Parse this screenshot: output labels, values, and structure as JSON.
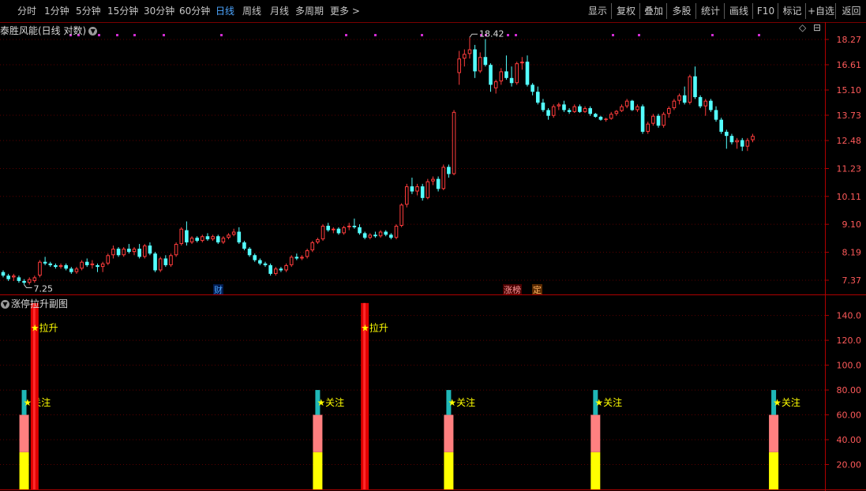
{
  "toolbar": {
    "periods": [
      "分时",
      "1分钟",
      "5分钟",
      "15分钟",
      "30分钟",
      "60分钟",
      "日线",
      "周线",
      "月线",
      "多周期",
      "更多"
    ],
    "active_period": "日线",
    "more_arrow": ">",
    "right_buttons": [
      "显示",
      "复权",
      "叠加",
      "多股",
      "统计",
      "画线",
      "F10",
      "标记",
      "+自选",
      "返回"
    ]
  },
  "main_chart": {
    "title": "泰胜风能(日线 对数)",
    "diamond_icon": "◇",
    "settings_icon": "⊟",
    "high_label": "18.42",
    "low_label": "7.25",
    "y_ticks": [
      "18.27",
      "16.61",
      "15.10",
      "13.73",
      "12.48",
      "11.23",
      "10.11",
      "9.10",
      "8.19",
      "7.37"
    ],
    "markers": {
      "cai": "财",
      "zhangbang": "涨榜",
      "ding": "定"
    }
  },
  "sub_chart": {
    "title": "涨停拉升副图",
    "y_ticks": [
      "140.0",
      "120.0",
      "100.0",
      "80.00",
      "60.00",
      "40.00",
      "20.00"
    ],
    "label_lasheng": "拉升",
    "label_guanzhu": "关注",
    "star": "★"
  },
  "chart_data": [
    {
      "type": "candlestick",
      "title": "泰胜风能(日线 对数)",
      "y_scale": "log",
      "ylim": [
        7.0,
        19.0
      ],
      "y_ticks": [
        18.27,
        16.61,
        15.1,
        13.73,
        12.48,
        11.23,
        10.11,
        9.1,
        8.19,
        7.37
      ],
      "annotations": {
        "high": 18.42,
        "low": 7.25
      },
      "colors": {
        "up": "#ff3c3c",
        "down": "#54ffff"
      },
      "candles": [
        [
          7.6,
          7.65,
          7.45,
          7.5
        ],
        [
          7.5,
          7.55,
          7.35,
          7.4
        ],
        [
          7.45,
          7.55,
          7.35,
          7.5
        ],
        [
          7.45,
          7.5,
          7.3,
          7.35
        ],
        [
          7.35,
          7.4,
          7.25,
          7.3
        ],
        [
          7.3,
          7.45,
          7.25,
          7.4
        ],
        [
          7.35,
          7.5,
          7.3,
          7.45
        ],
        [
          7.5,
          7.95,
          7.45,
          7.9
        ],
        [
          7.9,
          8.05,
          7.8,
          7.85
        ],
        [
          7.85,
          7.9,
          7.75,
          7.8
        ],
        [
          7.8,
          7.85,
          7.7,
          7.75
        ],
        [
          7.75,
          7.85,
          7.7,
          7.8
        ],
        [
          7.8,
          7.85,
          7.65,
          7.7
        ],
        [
          7.7,
          7.75,
          7.55,
          7.6
        ],
        [
          7.6,
          7.75,
          7.55,
          7.7
        ],
        [
          7.7,
          7.95,
          7.65,
          7.9
        ],
        [
          7.9,
          8.0,
          7.75,
          7.8
        ],
        [
          7.8,
          7.95,
          7.7,
          7.85
        ],
        [
          7.8,
          7.85,
          7.6,
          7.75
        ],
        [
          7.75,
          7.9,
          7.6,
          7.85
        ],
        [
          7.85,
          8.15,
          7.8,
          8.1
        ],
        [
          8.1,
          8.4,
          8.0,
          8.3
        ],
        [
          8.3,
          8.35,
          8.05,
          8.1
        ],
        [
          8.1,
          8.35,
          8.05,
          8.3
        ],
        [
          8.3,
          8.45,
          8.15,
          8.2
        ],
        [
          8.2,
          8.35,
          8.1,
          8.3
        ],
        [
          8.3,
          8.45,
          8.0,
          8.05
        ],
        [
          8.05,
          8.45,
          8.0,
          8.4
        ],
        [
          8.4,
          8.5,
          8.1,
          8.15
        ],
        [
          8.15,
          8.2,
          7.6,
          7.65
        ],
        [
          7.65,
          8.05,
          7.6,
          8.0
        ],
        [
          8.0,
          8.1,
          7.75,
          7.8
        ],
        [
          7.8,
          8.15,
          7.75,
          8.1
        ],
        [
          8.1,
          8.5,
          8.05,
          8.45
        ],
        [
          8.45,
          9.0,
          8.4,
          8.95
        ],
        [
          8.9,
          9.2,
          8.4,
          8.5
        ],
        [
          8.5,
          8.7,
          8.45,
          8.65
        ],
        [
          8.65,
          8.7,
          8.5,
          8.55
        ],
        [
          8.55,
          8.75,
          8.5,
          8.7
        ],
        [
          8.7,
          8.8,
          8.55,
          8.6
        ],
        [
          8.6,
          8.75,
          8.55,
          8.7
        ],
        [
          8.7,
          8.75,
          8.45,
          8.5
        ],
        [
          8.5,
          8.7,
          8.45,
          8.65
        ],
        [
          8.65,
          8.8,
          8.6,
          8.75
        ],
        [
          8.75,
          8.95,
          8.7,
          8.85
        ],
        [
          8.85,
          9.0,
          8.45,
          8.5
        ],
        [
          8.5,
          8.55,
          8.25,
          8.3
        ],
        [
          8.3,
          8.35,
          8.05,
          8.1
        ],
        [
          8.1,
          8.15,
          7.9,
          7.95
        ],
        [
          7.95,
          8.0,
          7.8,
          7.85
        ],
        [
          7.85,
          7.9,
          7.75,
          7.8
        ],
        [
          7.8,
          7.85,
          7.5,
          7.55
        ],
        [
          7.55,
          7.75,
          7.5,
          7.7
        ],
        [
          7.7,
          7.75,
          7.6,
          7.65
        ],
        [
          7.65,
          7.85,
          7.6,
          7.8
        ],
        [
          7.8,
          8.1,
          7.75,
          8.05
        ],
        [
          8.05,
          8.15,
          7.95,
          8.0
        ],
        [
          8.0,
          8.1,
          7.95,
          8.05
        ],
        [
          8.05,
          8.3,
          8.0,
          8.25
        ],
        [
          8.25,
          8.55,
          8.2,
          8.5
        ],
        [
          8.5,
          8.65,
          8.45,
          8.6
        ],
        [
          8.6,
          9.1,
          8.55,
          9.05
        ],
        [
          9.05,
          9.15,
          8.85,
          8.9
        ],
        [
          8.9,
          9.0,
          8.8,
          8.95
        ],
        [
          8.95,
          9.0,
          8.75,
          8.8
        ],
        [
          8.8,
          9.05,
          8.75,
          9.0
        ],
        [
          9.0,
          9.15,
          8.9,
          9.05
        ],
        [
          9.05,
          9.3,
          8.95,
          9.0
        ],
        [
          9.0,
          9.1,
          8.75,
          8.8
        ],
        [
          8.8,
          8.85,
          8.6,
          8.65
        ],
        [
          8.65,
          8.8,
          8.6,
          8.75
        ],
        [
          8.75,
          8.85,
          8.65,
          8.7
        ],
        [
          8.7,
          8.9,
          8.65,
          8.85
        ],
        [
          8.85,
          8.9,
          8.7,
          8.75
        ],
        [
          8.75,
          8.8,
          8.6,
          8.65
        ],
        [
          8.65,
          9.1,
          8.6,
          9.05
        ],
        [
          9.05,
          9.85,
          9.0,
          9.8
        ],
        [
          9.8,
          10.6,
          9.7,
          10.5
        ],
        [
          10.5,
          10.85,
          10.2,
          10.3
        ],
        [
          10.3,
          10.6,
          10.15,
          10.5
        ],
        [
          10.5,
          10.6,
          9.95,
          10.05
        ],
        [
          10.05,
          10.8,
          10.0,
          10.7
        ],
        [
          10.7,
          10.9,
          10.55,
          10.8
        ],
        [
          10.8,
          10.9,
          10.3,
          10.4
        ],
        [
          10.4,
          11.4,
          10.35,
          11.3
        ],
        [
          11.3,
          11.4,
          10.85,
          11.0
        ],
        [
          11.0,
          14.0,
          10.95,
          13.9
        ],
        [
          16.1,
          17.5,
          15.4,
          17.0
        ],
        [
          17.0,
          17.6,
          16.5,
          17.3
        ],
        [
          17.3,
          18.42,
          17.0,
          17.6
        ],
        [
          17.6,
          17.9,
          15.8,
          16.2
        ],
        [
          16.2,
          17.4,
          16.1,
          17.1
        ],
        [
          17.1,
          18.3,
          16.5,
          16.6
        ],
        [
          16.6,
          16.7,
          15.0,
          15.4
        ],
        [
          15.2,
          15.7,
          14.9,
          15.6
        ],
        [
          15.6,
          16.4,
          15.4,
          16.2
        ],
        [
          16.2,
          17.2,
          15.7,
          15.8
        ],
        [
          15.8,
          16.5,
          15.3,
          15.5
        ],
        [
          15.5,
          16.8,
          15.4,
          16.7
        ],
        [
          16.7,
          17.1,
          16.3,
          16.8
        ],
        [
          16.8,
          17.2,
          15.3,
          15.4
        ],
        [
          15.4,
          15.5,
          14.8,
          15.0
        ],
        [
          15.0,
          15.3,
          14.3,
          14.4
        ],
        [
          14.4,
          14.6,
          13.9,
          14.0
        ],
        [
          14.0,
          14.1,
          13.5,
          13.7
        ],
        [
          13.7,
          14.3,
          13.6,
          14.2
        ],
        [
          14.2,
          14.4,
          14.0,
          14.3
        ],
        [
          14.3,
          14.5,
          13.9,
          14.0
        ],
        [
          14.0,
          14.1,
          13.8,
          13.9
        ],
        [
          13.9,
          14.3,
          13.85,
          14.2
        ],
        [
          14.2,
          14.3,
          13.85,
          13.9
        ],
        [
          13.9,
          14.2,
          13.85,
          14.1
        ],
        [
          14.1,
          14.2,
          13.7,
          13.8
        ],
        [
          13.8,
          13.85,
          13.6,
          13.65
        ],
        [
          13.65,
          13.7,
          13.45,
          13.5
        ],
        [
          13.5,
          13.6,
          13.4,
          13.55
        ],
        [
          13.55,
          13.9,
          13.5,
          13.8
        ],
        [
          13.8,
          14.0,
          13.7,
          13.95
        ],
        [
          13.95,
          14.3,
          13.9,
          14.2
        ],
        [
          14.2,
          14.6,
          14.1,
          14.5
        ],
        [
          14.5,
          14.55,
          13.95,
          14.0
        ],
        [
          14.0,
          14.3,
          13.9,
          14.2
        ],
        [
          14.2,
          14.3,
          12.8,
          12.9
        ],
        [
          12.9,
          13.4,
          12.8,
          13.3
        ],
        [
          13.3,
          13.8,
          13.2,
          13.7
        ],
        [
          13.7,
          13.8,
          13.1,
          13.2
        ],
        [
          13.2,
          13.9,
          13.1,
          13.8
        ],
        [
          13.8,
          14.2,
          13.6,
          14.1
        ],
        [
          14.1,
          14.6,
          14.0,
          14.5
        ],
        [
          14.5,
          14.9,
          14.3,
          14.8
        ],
        [
          14.8,
          15.3,
          14.3,
          14.4
        ],
        [
          14.4,
          16.0,
          14.3,
          15.9
        ],
        [
          15.9,
          16.5,
          14.6,
          14.7
        ],
        [
          14.7,
          14.8,
          14.1,
          14.2
        ],
        [
          14.2,
          14.6,
          13.7,
          14.5
        ],
        [
          14.5,
          14.6,
          13.9,
          14.0
        ],
        [
          14.0,
          14.2,
          13.4,
          13.5
        ],
        [
          13.5,
          13.6,
          12.8,
          12.9
        ],
        [
          12.9,
          13.0,
          12.1,
          12.7
        ],
        [
          12.7,
          12.8,
          12.3,
          12.4
        ],
        [
          12.4,
          12.6,
          12.1,
          12.5
        ],
        [
          12.5,
          12.6,
          12.0,
          12.2
        ],
        [
          12.2,
          12.6,
          12.0,
          12.5
        ],
        [
          12.5,
          12.8,
          12.4,
          12.7
        ]
      ]
    },
    {
      "type": "bar",
      "title": "涨停拉升副图",
      "ylim": [
        0,
        155
      ],
      "y_ticks": [
        140,
        120,
        100,
        80,
        60,
        40,
        20
      ],
      "stacked_signals": [
        {
          "candle": 4,
          "yellow": 30,
          "pink": 60,
          "cyan": 80,
          "label": "关注"
        },
        {
          "candle": 60,
          "yellow": 30,
          "pink": 60,
          "cyan": 80,
          "label": "关注"
        },
        {
          "candle": 85,
          "yellow": 30,
          "pink": 60,
          "cyan": 80,
          "label": "关注"
        },
        {
          "candle": 113,
          "yellow": 30,
          "pink": 60,
          "cyan": 80,
          "label": "关注"
        },
        {
          "candle": 147,
          "yellow": 30,
          "pink": 60,
          "cyan": 80,
          "label": "关注"
        }
      ],
      "lift_signals": [
        {
          "candle": 6,
          "value": 150,
          "label_value": 130,
          "label": "拉升"
        },
        {
          "candle": 69,
          "value": 150,
          "label_value": 130,
          "label": "拉升"
        }
      ],
      "colors": {
        "yellow": "#ffff00",
        "pink": "#ff8080",
        "cyan": "#1fb7b7",
        "red": "#e00000"
      }
    }
  ]
}
